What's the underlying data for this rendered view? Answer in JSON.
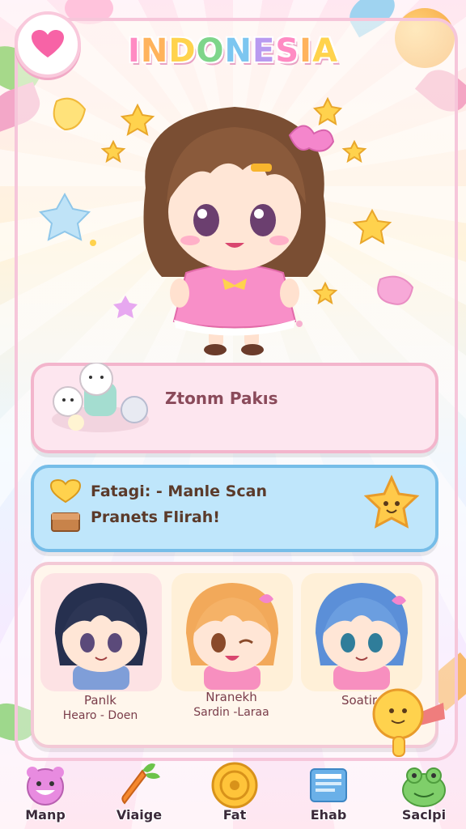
{
  "title": "INDONESIA",
  "pink_card": {
    "label": "Ztonm Pakıs"
  },
  "blue_card": {
    "line1": "Fatagi: - Manle Scan",
    "line2": "Pranets Flirah!"
  },
  "characters": [
    {
      "name": "Panlk",
      "sub": "Hearo - Doen"
    },
    {
      "name": "Nranekh",
      "sub": "Sardin -Laraa"
    },
    {
      "name": "Soatir",
      "sub": ""
    }
  ],
  "nav": [
    {
      "label": "Manp",
      "icon": "pig-icon"
    },
    {
      "label": "Viaige",
      "icon": "carrot-icon"
    },
    {
      "label": "Fat",
      "icon": "coin-icon"
    },
    {
      "label": "Ehab",
      "icon": "book-icon"
    },
    {
      "label": "Saclpi",
      "icon": "frog-icon"
    }
  ],
  "colors": {
    "accent_pink": "#ff7fb7",
    "card_blue": "#bfe6fb",
    "card_pink": "#fde6ef"
  }
}
